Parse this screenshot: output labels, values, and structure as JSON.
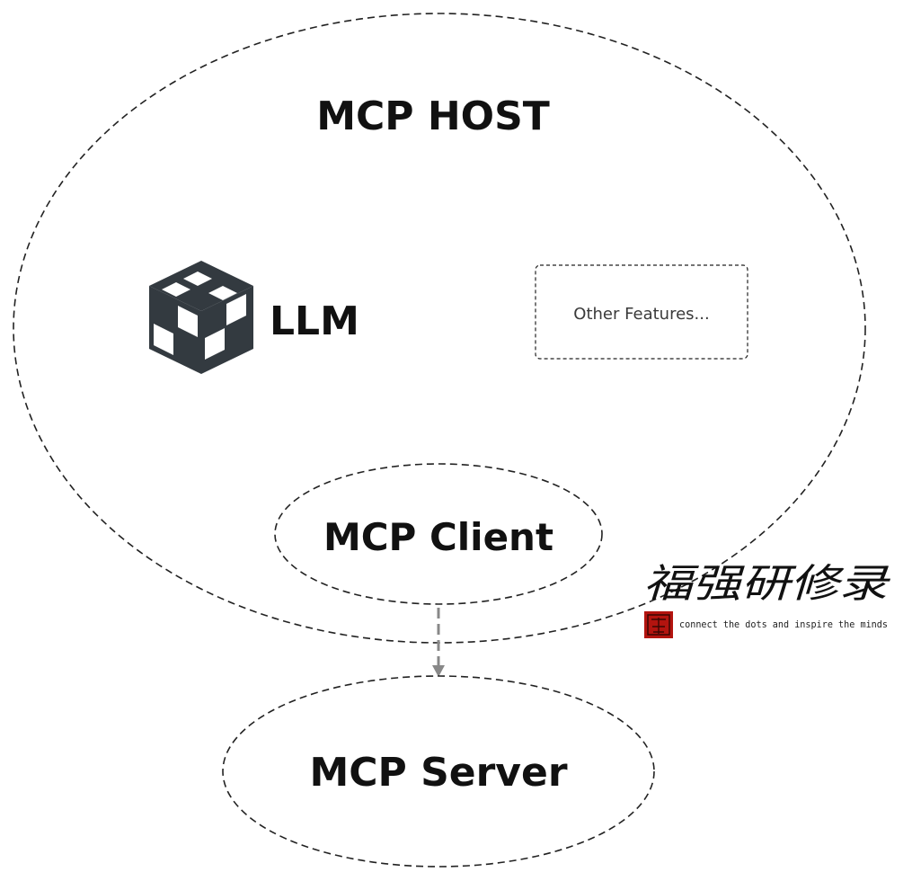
{
  "host": {
    "label": "MCP HOST"
  },
  "llm": {
    "label": "LLM",
    "icon": "cube-icon"
  },
  "features": {
    "label": "Other Features..."
  },
  "client": {
    "label": "MCP Client"
  },
  "server": {
    "label": "MCP Server"
  },
  "watermark": {
    "title": "福强研修录",
    "tagline": "connect the dots and inspire the minds",
    "seal_icon": "red-seal-icon"
  },
  "colors": {
    "stroke": "#222222",
    "icon": "#333a40",
    "arrow": "#888888",
    "seal": "#b3140f"
  }
}
